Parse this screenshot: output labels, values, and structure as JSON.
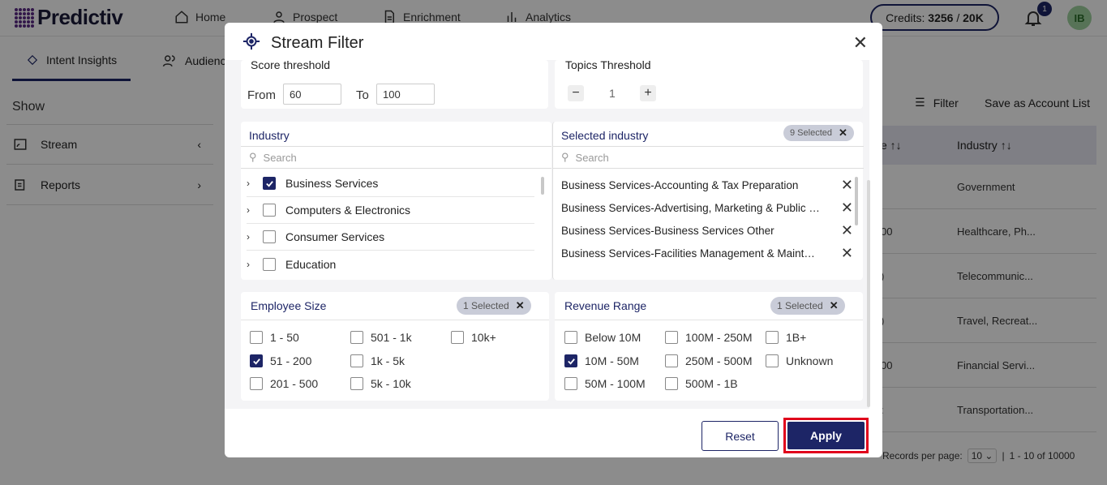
{
  "app": {
    "logo_text": "Predictiv"
  },
  "nav": {
    "home": "Home",
    "prospect": "Prospect",
    "enrichment": "Enrichment",
    "analytics": "Analytics"
  },
  "credits": {
    "label": "Credits:",
    "used": "3256",
    "sep": "/",
    "total": "20K"
  },
  "notifications": {
    "count": "1"
  },
  "user": {
    "initials": "IB"
  },
  "subtabs": {
    "intent": "Intent Insights",
    "audience": "Audience"
  },
  "sidebar": {
    "show": "Show",
    "stream": "Stream",
    "reports": "Reports"
  },
  "toolbar": {
    "filter": "Filter",
    "save": "Save as Account List"
  },
  "table": {
    "headers": [
      "e ↑↓",
      "Industry ↑↓"
    ],
    "rows": [
      [
        "",
        "Government"
      ],
      [
        "00",
        "Healthcare, Ph..."
      ],
      [
        ")",
        "Telecommunic..."
      ],
      [
        ")",
        "Travel, Recreat..."
      ],
      [
        "00",
        "Financial Servi..."
      ],
      [
        ":",
        "Transportation..."
      ]
    ]
  },
  "footer": {
    "records_label": "Records per page:",
    "per_page": "10",
    "range": "1 - 10 of 10000"
  },
  "modal": {
    "title": "Stream Filter",
    "score": {
      "title": "Score threshold",
      "from_label": "From",
      "from_value": "60",
      "to_label": "To",
      "to_value": "100"
    },
    "topics": {
      "title": "Topics Threshold",
      "value": "1",
      "minus": "−",
      "plus": "+"
    },
    "industry": {
      "title": "Industry",
      "search_placeholder": "Search",
      "items": [
        {
          "label": "Business Services",
          "checked": true
        },
        {
          "label": "Computers & Electronics",
          "checked": false
        },
        {
          "label": "Consumer Services",
          "checked": false
        },
        {
          "label": "Education",
          "checked": false
        }
      ]
    },
    "selected_industry": {
      "title": "Selected industry",
      "badge": "9 Selected",
      "search_placeholder": "Search",
      "items": [
        "Business Services-Accounting & Tax Preparation",
        "Business Services-Advertising, Marketing & Public Relations",
        "Business Services-Business Services Other",
        "Business Services-Facilities Management & Maintenance"
      ]
    },
    "employee": {
      "title": "Employee Size",
      "badge": "1 Selected",
      "options": [
        {
          "label": "1 - 50",
          "checked": false
        },
        {
          "label": "501 - 1k",
          "checked": false
        },
        {
          "label": "10k+",
          "checked": false
        },
        {
          "label": "51 - 200",
          "checked": true
        },
        {
          "label": "1k - 5k",
          "checked": false
        },
        {
          "label": "201 - 500",
          "checked": false
        },
        {
          "label": "5k - 10k",
          "checked": false
        }
      ]
    },
    "revenue": {
      "title": "Revenue Range",
      "badge": "1 Selected",
      "options": [
        {
          "label": "Below 10M",
          "checked": false
        },
        {
          "label": "100M - 250M",
          "checked": false
        },
        {
          "label": "1B+",
          "checked": false
        },
        {
          "label": "10M - 50M",
          "checked": true
        },
        {
          "label": "250M - 500M",
          "checked": false
        },
        {
          "label": "Unknown",
          "checked": false
        },
        {
          "label": "50M - 100M",
          "checked": false
        },
        {
          "label": "500M - 1B",
          "checked": false
        }
      ]
    },
    "reset": "Reset",
    "apply": "Apply"
  }
}
